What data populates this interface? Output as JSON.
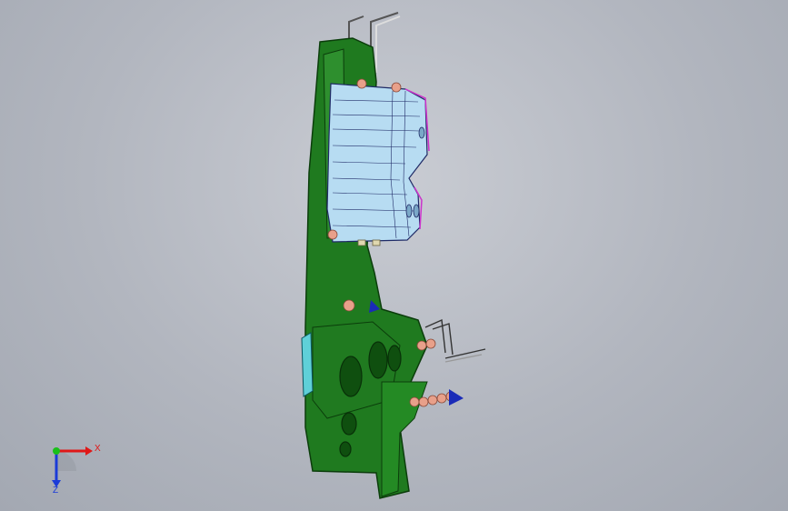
{
  "viewport": {
    "background_top": "#c9ccd3",
    "background_bottom": "#a3a8b2"
  },
  "model": {
    "body_color": "#1f7a1f",
    "body_edge_color": "#0b3d0b",
    "shell_color": "#b7dcf2",
    "shell_edge_color": "#1f2a66",
    "accent_magenta": "#cc33cc",
    "fastener_color": "#e8a08a",
    "marker_color": "#1a2bb8"
  },
  "triad": {
    "x_label": "X",
    "z_label": "Z",
    "x_color": "#e01818",
    "y_color": "#19c019",
    "z_color": "#1b3bd8"
  }
}
